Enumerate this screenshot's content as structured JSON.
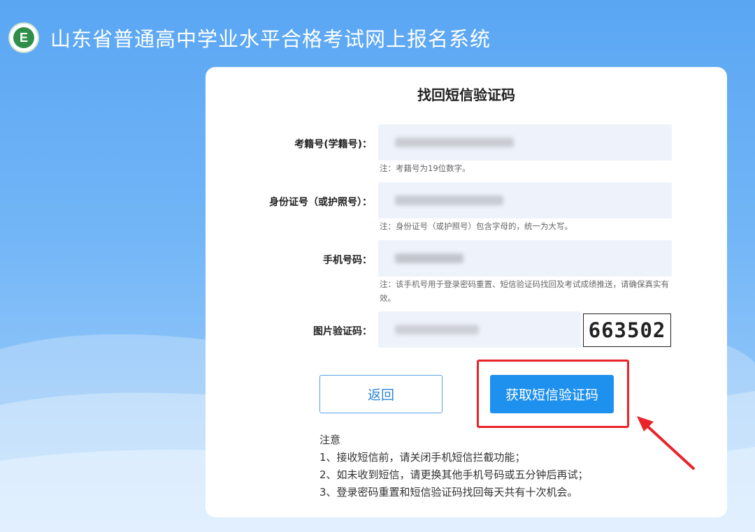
{
  "header": {
    "logo_letter": "E",
    "title": "山东省普通高中学业水平合格考试网上报名系统"
  },
  "form": {
    "title": "找回短信验证码",
    "exam_id": {
      "label": "考籍号(学籍号)：",
      "note": "注：考籍号为19位数字。"
    },
    "id_card": {
      "label": "身份证号（或护照号）：",
      "note": "注：身份证号（或护照号）包含字母的，统一为大写。"
    },
    "phone": {
      "label": "手机号码：",
      "note": "注：该手机号用于登录密码重置、短信验证码找回及考试成绩推送，请确保真实有效。"
    },
    "captcha": {
      "label": "图片验证码：",
      "image_text": "663502"
    }
  },
  "buttons": {
    "back": "返回",
    "get_sms": "获取短信验证码"
  },
  "tips": {
    "heading": "注意",
    "items": [
      "1、接收短信前，请关闭手机短信拦截功能；",
      "2、如未收到短信，请更换其他手机号码或五分钟后再试；",
      "3、登录密码重置和短信验证码找回每天共有十次机会。"
    ]
  },
  "colors": {
    "background_top": "#5aa6f3",
    "primary_button": "#1e90ee",
    "highlight_box": "#e8242a",
    "field_bg": "#eef3fb"
  }
}
